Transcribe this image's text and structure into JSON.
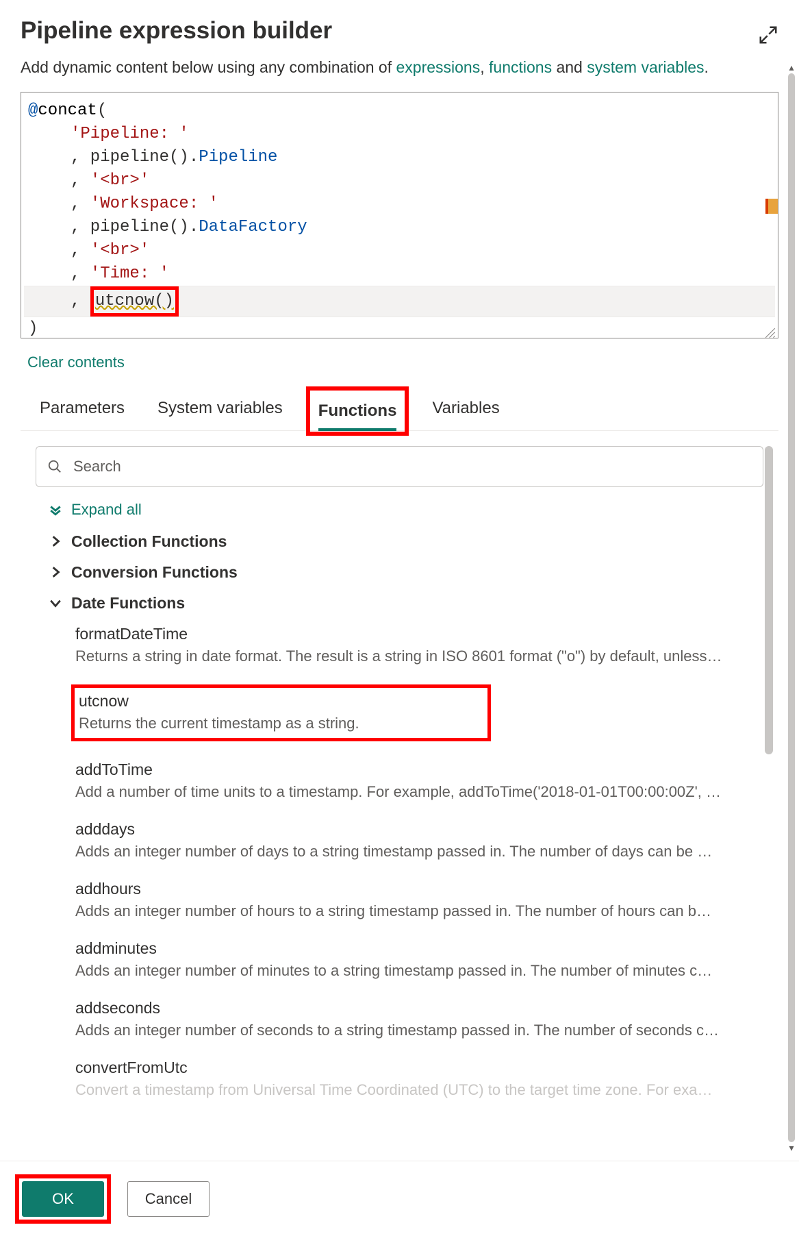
{
  "header": {
    "title": "Pipeline expression builder",
    "subtitle_pre": "Add dynamic content below using any combination of ",
    "link_expressions": "expressions",
    "sep1": ", ",
    "link_functions": "functions",
    "sep2": " and ",
    "link_sysvars": "system variables",
    "period": "."
  },
  "editor": {
    "l1_at": "@",
    "l1_fn": "concat",
    "l1_p": "(",
    "l2": "'Pipeline: '",
    "l3_pre": ", pipeline().",
    "l3_prop": "Pipeline",
    "l4_pre": ", ",
    "l4_str": "'<br>'",
    "l5_pre": ", ",
    "l5_str": "'Workspace: '",
    "l6_pre": ", pipeline().",
    "l6_prop": "DataFactory",
    "l7_pre": ", ",
    "l7_str": "'<br>'",
    "l8_pre": ", ",
    "l8_str": "'Time: '",
    "l9_pre": ", ",
    "l9_fn": "utcnow()",
    "l10": ")"
  },
  "clear_contents": "Clear contents",
  "tabs": {
    "parameters": "Parameters",
    "system_variables": "System variables",
    "functions": "Functions",
    "variables": "Variables"
  },
  "search": {
    "placeholder": "Search"
  },
  "expand_all": "Expand all",
  "categories": {
    "collection": "Collection Functions",
    "conversion": "Conversion Functions",
    "date": "Date Functions"
  },
  "items": [
    {
      "name": "formatDateTime",
      "desc": "Returns a string in date format. The result is a string in ISO 8601 format (\"o\") by default, unless…"
    },
    {
      "name": "utcnow",
      "desc": "Returns the current timestamp as a string."
    },
    {
      "name": "addToTime",
      "desc": "Add a number of time units to a timestamp. For example, addToTime('2018-01-01T00:00:00Z', …"
    },
    {
      "name": "adddays",
      "desc": "Adds an integer number of days to a string timestamp passed in. The number of days can be …"
    },
    {
      "name": "addhours",
      "desc": "Adds an integer number of hours to a string timestamp passed in. The number of hours can b…"
    },
    {
      "name": "addminutes",
      "desc": "Adds an integer number of minutes to a string timestamp passed in. The number of minutes c…"
    },
    {
      "name": "addseconds",
      "desc": "Adds an integer number of seconds to a string timestamp passed in. The number of seconds c…"
    },
    {
      "name": "convertFromUtc",
      "desc": "Convert a timestamp from Universal Time Coordinated (UTC) to the target time zone. For exa…"
    }
  ],
  "footer": {
    "ok": "OK",
    "cancel": "Cancel"
  }
}
